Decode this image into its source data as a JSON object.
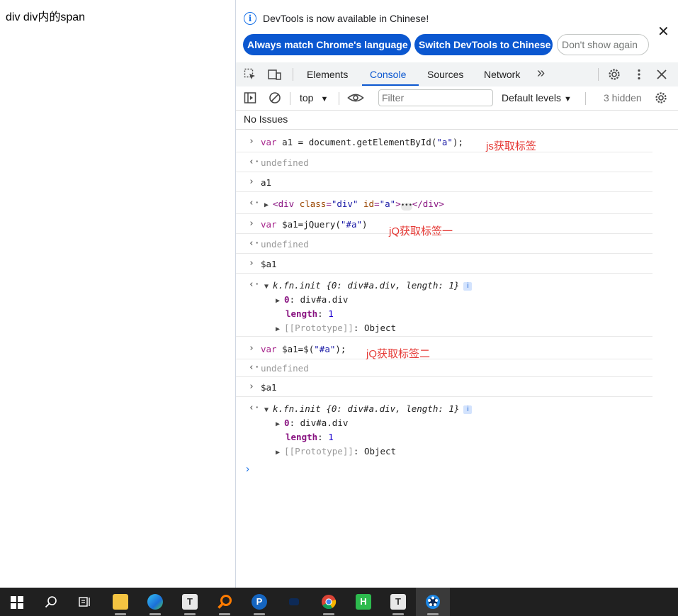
{
  "page": {
    "text": "div div内的span"
  },
  "infobar": {
    "message": "DevTools is now available in Chinese!",
    "btn_match": "Always match Chrome's language",
    "btn_switch": "Switch DevTools to Chinese",
    "btn_dismiss": "Don't show again",
    "info_icon": "i",
    "close_icon": "✕"
  },
  "tabs": {
    "elements": "Elements",
    "console": "Console",
    "sources": "Sources",
    "network": "Network",
    "more": "»"
  },
  "toolbar": {
    "context": "top",
    "filter_placeholder": "Filter",
    "levels": "Default levels",
    "hidden": "3 hidden"
  },
  "issues": "No Issues",
  "console": {
    "l1_kw": "var",
    "l1_rest": " a1 = document.getElementById(",
    "l1_str": "\"a\"",
    "l1_end": ");",
    "note1": "js获取标签",
    "undefined": "undefined",
    "l3": "a1",
    "l4_open": "<div ",
    "l4_attr1": "class",
    "l4_val1": "\"div\"",
    "l4_attr2": "id",
    "l4_val2": "\"a\"",
    "l4_close": "</div>",
    "l5_kw": "var",
    "l5_rest": " $a1=jQuery(",
    "l5_str": "\"#a\"",
    "l5_end": ")",
    "note2": "jQ获取标签一",
    "l7": "$a1",
    "obj_name": "k.fn.init",
    "obj_summary": "{0: div#a.div, length: 1}",
    "prop0_key": "0",
    "prop0_val": "div#a.div",
    "len_key": "length",
    "len_val": "1",
    "proto_key": "[[Prototype]]",
    "proto_val": "Object",
    "l9_kw": "var",
    "l9_rest": " $a1=$(",
    "l9_str": "\"#a\"",
    "l9_end": ");",
    "note3": "jQ获取标签二",
    "l11": "$a1"
  },
  "taskbar": {
    "apps": [
      "start",
      "search",
      "task-view",
      "file-explorer",
      "edge",
      "typora",
      "search-tool",
      "pycharm",
      "app-blue",
      "chrome",
      "hbuilder",
      "typora-2",
      "app-active"
    ]
  }
}
